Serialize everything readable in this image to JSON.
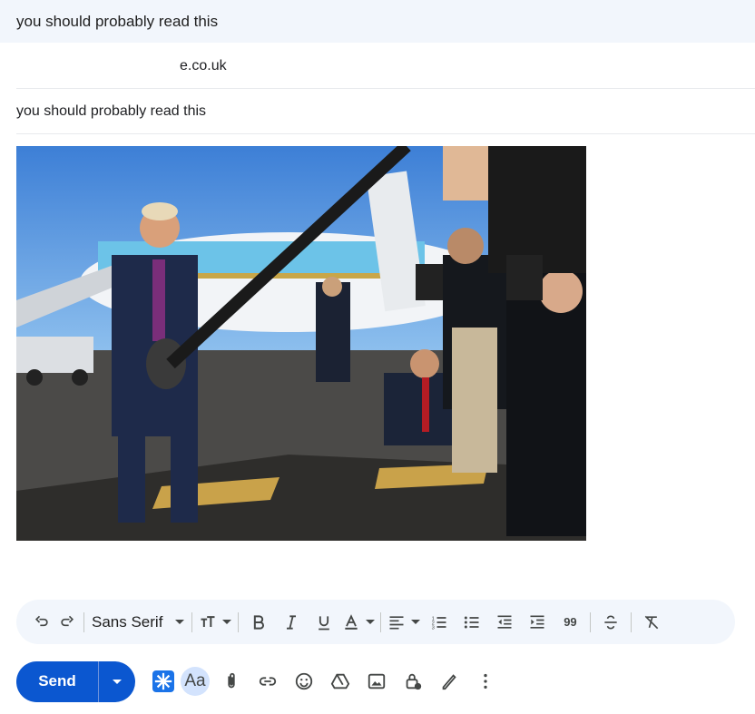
{
  "window": {
    "title": "you should probably read this"
  },
  "compose": {
    "to_visible": "e.co.uk",
    "subject": "you should probably read this"
  },
  "formatting": {
    "font": "Sans Serif",
    "quote_glyph": "99"
  },
  "actions": {
    "send_label": "Send",
    "text_format_label": "Aa"
  },
  "icons": [
    "undo-icon",
    "redo-icon",
    "text-size-icon",
    "bold-icon",
    "italic-icon",
    "underline-icon",
    "text-color-icon",
    "align-icon",
    "numbered-list-icon",
    "bulleted-list-icon",
    "indent-less-icon",
    "indent-more-icon",
    "quote-icon",
    "strikethrough-icon",
    "remove-formatting-icon",
    "gemini-icon",
    "attach-icon",
    "link-icon",
    "emoji-icon",
    "drive-icon",
    "photo-icon",
    "confidential-icon",
    "signature-icon",
    "more-options-icon"
  ],
  "colors": {
    "accent": "#0b57d0",
    "bar_bg": "#f2f6fc"
  }
}
